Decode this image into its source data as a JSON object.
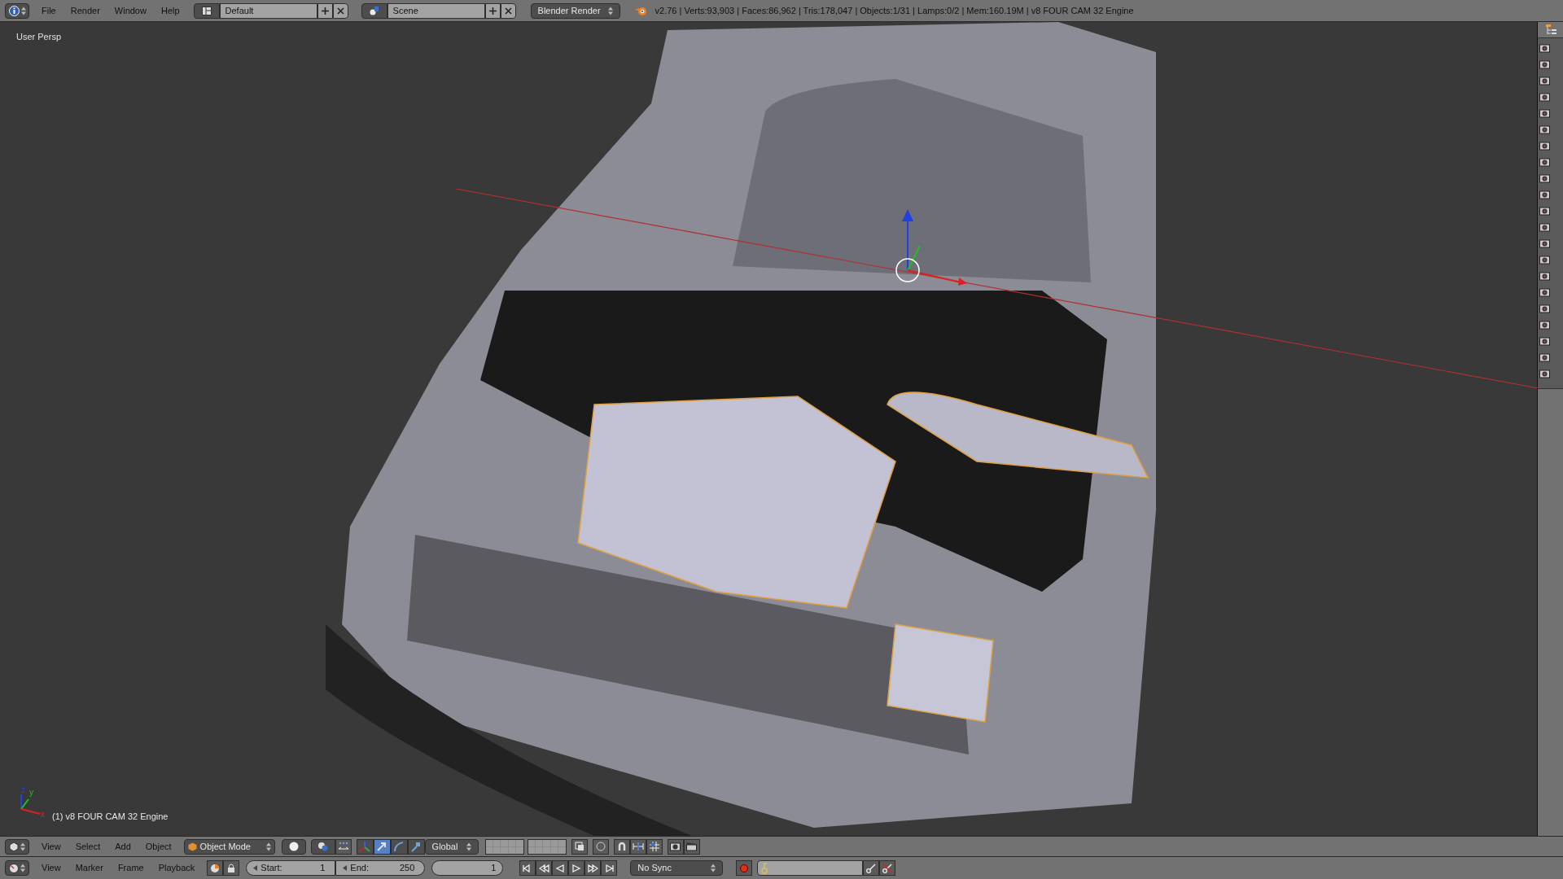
{
  "top_bar": {
    "menus": [
      "File",
      "Render",
      "Window",
      "Help"
    ],
    "layout": "Default",
    "scene": "Scene",
    "engine": "Blender Render",
    "status": "v2.76 | Verts:93,903 | Faces:86,962 | Tris:178,047 | Objects:1/31 | Lamps:0/2 | Mem:160.19M | v8 FOUR CAM 32 Engine"
  },
  "viewport": {
    "view_name": "User Persp",
    "axes": [
      "x",
      "y",
      "z"
    ],
    "object_label": "(1) v8 FOUR CAM 32 Engine"
  },
  "view3d_header": {
    "menus": [
      "View",
      "Select",
      "Add",
      "Object"
    ],
    "mode": "Object Mode",
    "orientation": "Global",
    "manipulators": [
      {
        "kind": "axes",
        "selected": false
      },
      {
        "kind": "translate",
        "selected": true
      },
      {
        "kind": "rotate",
        "selected": false
      },
      {
        "kind": "scale",
        "selected": false
      }
    ]
  },
  "timeline_header": {
    "menus": [
      "View",
      "Marker",
      "Frame",
      "Playback"
    ],
    "start_label": "Start:",
    "start": "1",
    "end_label": "End:",
    "end": "250",
    "current": "1",
    "sync": "No Sync"
  }
}
